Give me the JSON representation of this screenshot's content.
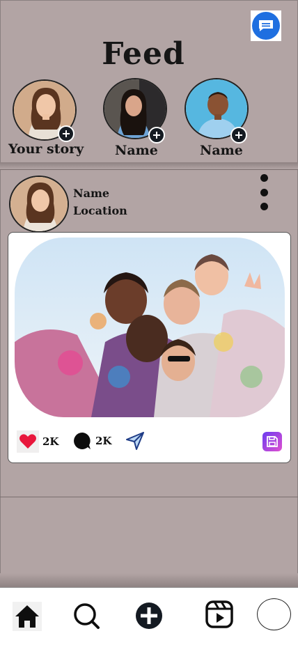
{
  "header": {
    "title": "Feed",
    "messages_icon": "message-icon"
  },
  "stories": [
    {
      "label": "Your story",
      "avatar": "girl-in-white-top",
      "badge_icon": "add-icon"
    },
    {
      "label": "Name",
      "avatar": "girl-in-blue-dress",
      "badge_icon": "add-icon"
    },
    {
      "label": "Name",
      "avatar": "boy-in-blue-shirt",
      "badge_icon": "add-icon"
    }
  ],
  "post": {
    "author_name": "Name",
    "location": "Location",
    "more_icon": "more-vertical-icon",
    "image": "friends-with-holi-colors",
    "likes": "2K",
    "comments": "2K",
    "like_icon": "heart-icon",
    "comment_icon": "comment-icon",
    "share_icon": "send-icon",
    "save_icon": "save-icon"
  },
  "nav": {
    "items": [
      "home-icon",
      "search-icon",
      "add-post-icon",
      "reels-icon",
      "profile-icon"
    ]
  },
  "colors": {
    "background": "#b2a4a4",
    "accent_blue": "#1f6fe0",
    "like_red": "#e8173c",
    "save_gradient_start": "#6a3cf0",
    "save_gradient_end": "#e04fd0"
  }
}
